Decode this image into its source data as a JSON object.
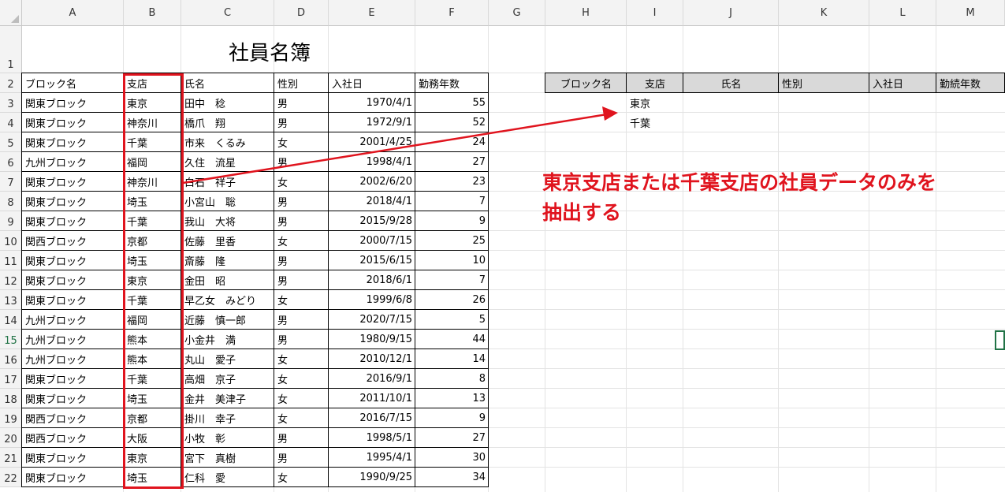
{
  "columns": [
    "A",
    "B",
    "C",
    "D",
    "E",
    "F",
    "G",
    "H",
    "I",
    "J",
    "K",
    "L",
    "M"
  ],
  "rows": [
    "1",
    "2",
    "3",
    "4",
    "5",
    "6",
    "7",
    "8",
    "9",
    "10",
    "11",
    "12",
    "13",
    "14",
    "15",
    "16",
    "17",
    "18",
    "19",
    "20",
    "21",
    "22"
  ],
  "title": "社員名簿",
  "table_headers": [
    "ブロック名",
    "支店",
    "氏名",
    "性別",
    "入社日",
    "勤務年数"
  ],
  "records": [
    [
      "関東ブロック",
      "東京",
      "田中　稔",
      "男",
      "1970/4/1",
      "55"
    ],
    [
      "関東ブロック",
      "神奈川",
      "橋爪　翔",
      "男",
      "1972/9/1",
      "52"
    ],
    [
      "関東ブロック",
      "千葉",
      "市来　くるみ",
      "女",
      "2001/4/25",
      "24"
    ],
    [
      "九州ブロック",
      "福岡",
      "久住　流星",
      "男",
      "1998/4/1",
      "27"
    ],
    [
      "関東ブロック",
      "神奈川",
      "白石　祥子",
      "女",
      "2002/6/20",
      "23"
    ],
    [
      "関東ブロック",
      "埼玉",
      "小宮山　聡",
      "男",
      "2018/4/1",
      "7"
    ],
    [
      "関東ブロック",
      "千葉",
      "我山　大将",
      "男",
      "2015/9/28",
      "9"
    ],
    [
      "関西ブロック",
      "京都",
      "佐藤　里香",
      "女",
      "2000/7/15",
      "25"
    ],
    [
      "関東ブロック",
      "埼玉",
      "斎藤　隆",
      "男",
      "2015/6/15",
      "10"
    ],
    [
      "関東ブロック",
      "東京",
      "金田　昭",
      "男",
      "2018/6/1",
      "7"
    ],
    [
      "関東ブロック",
      "千葉",
      "早乙女　みどり",
      "女",
      "1999/6/8",
      "26"
    ],
    [
      "九州ブロック",
      "福岡",
      "近藤　慎一郎",
      "男",
      "2020/7/15",
      "5"
    ],
    [
      "九州ブロック",
      "熊本",
      "小金井　満",
      "男",
      "1980/9/15",
      "44"
    ],
    [
      "九州ブロック",
      "熊本",
      "丸山　愛子",
      "女",
      "2010/12/1",
      "14"
    ],
    [
      "関東ブロック",
      "千葉",
      "高畑　京子",
      "女",
      "2016/9/1",
      "8"
    ],
    [
      "関東ブロック",
      "埼玉",
      "金井　美津子",
      "女",
      "2011/10/1",
      "13"
    ],
    [
      "関西ブロック",
      "京都",
      "掛川　幸子",
      "女",
      "2016/7/15",
      "9"
    ],
    [
      "関西ブロック",
      "大阪",
      "小牧　彰",
      "男",
      "1998/5/1",
      "27"
    ],
    [
      "関東ブロック",
      "東京",
      "宮下　真樹",
      "男",
      "1995/4/1",
      "30"
    ],
    [
      "関東ブロック",
      "埼玉",
      "仁科　愛",
      "女",
      "1990/9/25",
      "34"
    ]
  ],
  "criteria_headers": [
    "ブロック名",
    "支店",
    "氏名",
    "性別",
    "入社日",
    "勤続年数"
  ],
  "criteria_values": [
    "東京",
    "千葉"
  ],
  "annotation": [
    "東京支店または千葉支店の社員データのみを",
    "抽出する"
  ],
  "colors": {
    "annotation": "#e0141e",
    "header_fill": "#d9d9d9",
    "selection": "#217346"
  },
  "active_row": "15"
}
